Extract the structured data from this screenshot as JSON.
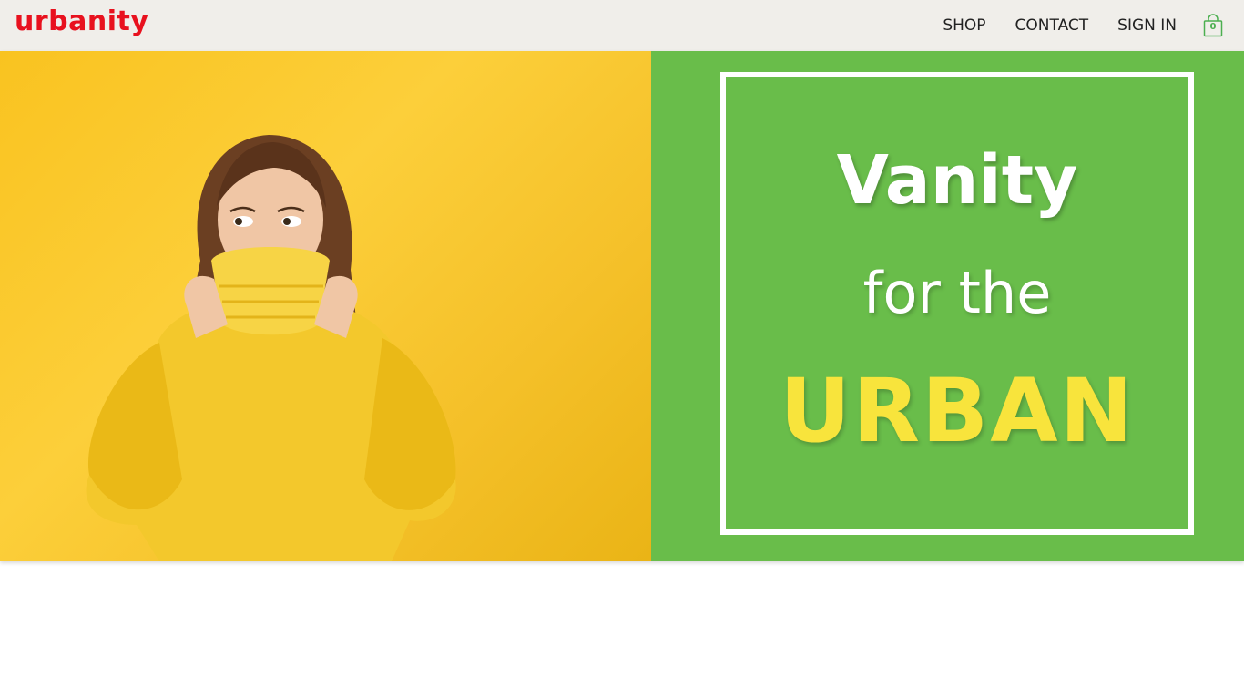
{
  "brand": {
    "logo_text": "urbanity",
    "logo_color": "#e8111e"
  },
  "nav": {
    "links": [
      {
        "label": "SHOP"
      },
      {
        "label": "CONTACT"
      },
      {
        "label": "SIGN IN"
      }
    ],
    "cart": {
      "icon": "shopping-bag-icon",
      "count": "0",
      "color": "#4caf50"
    }
  },
  "hero": {
    "image": {
      "description_icon": "model-photo",
      "background": "#f9c320"
    },
    "panel": {
      "background": "#69bd4a",
      "line1": "Vanity",
      "line2": "for the",
      "line3": "URBAN",
      "accent": "#f8e43c"
    }
  }
}
